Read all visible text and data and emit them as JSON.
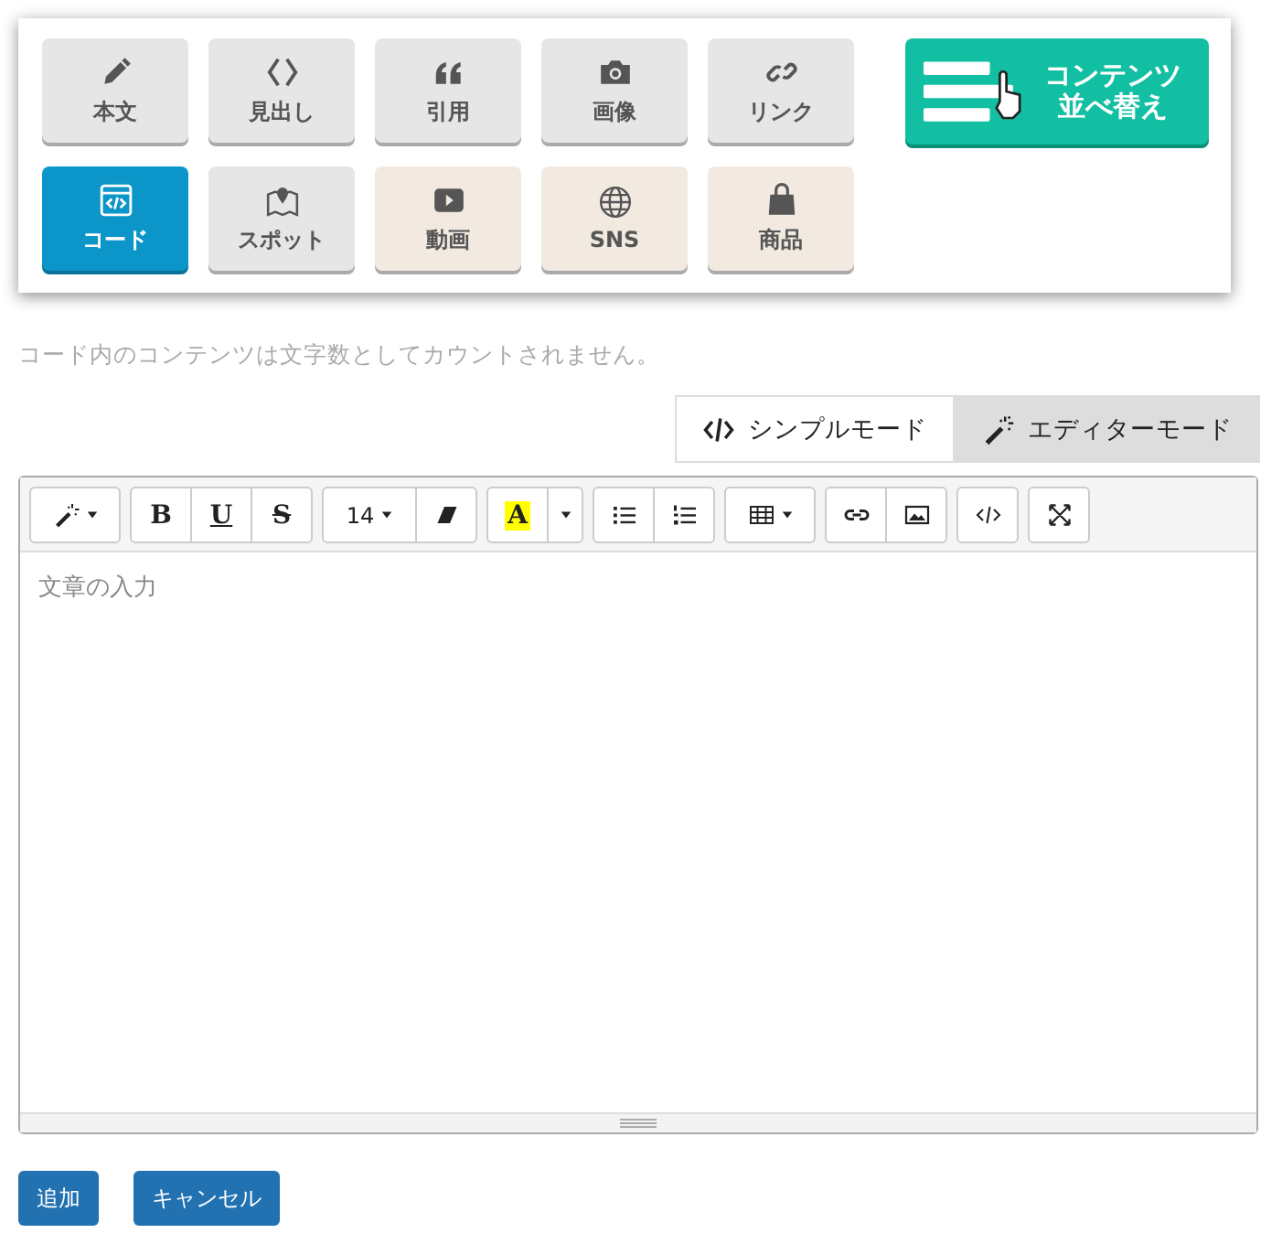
{
  "content_types": [
    {
      "label": "本文",
      "kind": "pencil",
      "selected": false,
      "color": "#e6e6e6"
    },
    {
      "label": "見出し",
      "kind": "brackets",
      "selected": false,
      "color": "#e6e6e6"
    },
    {
      "label": "引用",
      "kind": "quote",
      "selected": false,
      "color": "#e6e6e6"
    },
    {
      "label": "画像",
      "kind": "camera",
      "selected": false,
      "color": "#e6e6e6"
    },
    {
      "label": "リンク",
      "kind": "link",
      "selected": false,
      "color": "#e6e6e6"
    },
    {
      "label": "コード",
      "kind": "code",
      "selected": true
    },
    {
      "label": "スポット",
      "kind": "map",
      "selected": false,
      "color": "#e6e6e6"
    },
    {
      "label": "動画",
      "kind": "video",
      "selected": false,
      "color": "#f2e9e1"
    },
    {
      "label": "SNS",
      "kind": "globe",
      "selected": false,
      "color": "#f2e9e1"
    },
    {
      "label": "商品",
      "kind": "bag",
      "selected": false,
      "color": "#f2e9e1"
    }
  ],
  "sort_button": {
    "line_1": "コンテンツ",
    "line_2": "並べ替え"
  },
  "note": "コード内のコンテンツは文字数としてカウントされません。",
  "modes": [
    {
      "label": "シンプルモード",
      "kind": "code",
      "selected": false
    },
    {
      "label": "エディターモード",
      "kind": "wand",
      "selected": true
    }
  ],
  "toolbar": [
    [
      {
        "kind": "wand",
        "caret": true
      }
    ],
    [
      {
        "kind": "bold",
        "label": "B"
      },
      {
        "kind": "underline",
        "label": "U"
      },
      {
        "kind": "strike",
        "label": "S"
      }
    ],
    [
      {
        "kind": "size",
        "label": "14",
        "caret": true
      },
      {
        "kind": "eraser"
      }
    ],
    [
      {
        "kind": "color",
        "label": "A"
      },
      {
        "kind": "caret"
      }
    ],
    [
      {
        "kind": "ul"
      },
      {
        "kind": "ol"
      }
    ],
    [
      {
        "kind": "table",
        "caret": true
      }
    ],
    [
      {
        "kind": "link"
      },
      {
        "kind": "image"
      }
    ],
    [
      {
        "kind": "code"
      }
    ],
    [
      {
        "kind": "fullscreen"
      }
    ]
  ],
  "editor": {
    "placeholder": "文章の入力"
  },
  "buttons": [
    "追加",
    "キャンセル"
  ]
}
